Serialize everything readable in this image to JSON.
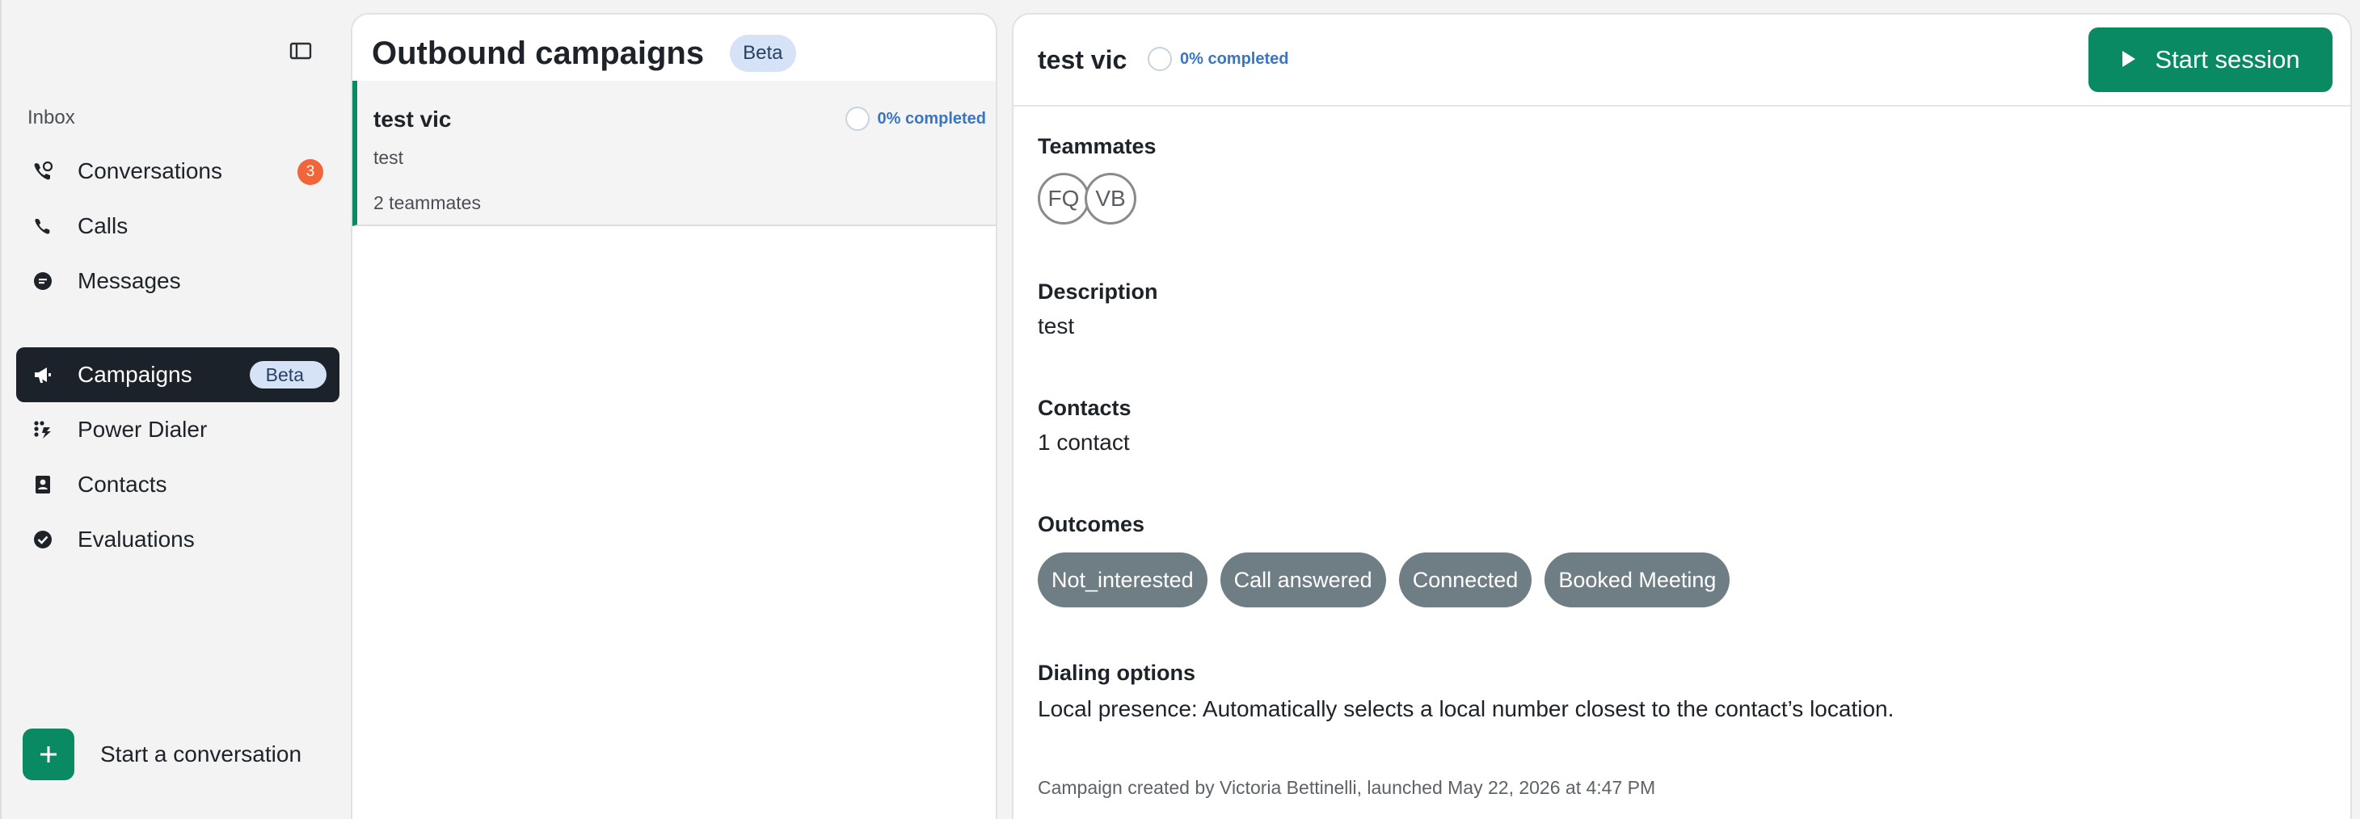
{
  "sidebar": {
    "section_label": "Inbox",
    "items": [
      {
        "label": "Conversations",
        "icon": "phone-chat-icon",
        "badge": "3"
      },
      {
        "label": "Calls",
        "icon": "phone-icon"
      },
      {
        "label": "Messages",
        "icon": "message-icon"
      },
      {
        "label": "Campaigns",
        "icon": "megaphone-icon",
        "badge": "Beta",
        "active": true
      },
      {
        "label": "Power Dialer",
        "icon": "power-dialer-icon"
      },
      {
        "label": "Contacts",
        "icon": "contacts-icon"
      },
      {
        "label": "Evaluations",
        "icon": "check-circle-icon"
      }
    ],
    "start_conversation": "Start a conversation"
  },
  "list": {
    "title": "Outbound campaigns",
    "beta": "Beta",
    "campaigns": [
      {
        "name": "test vic",
        "progress": "0% completed",
        "description": "test",
        "teammates": "2 teammates"
      }
    ]
  },
  "detail": {
    "title": "test vic",
    "progress": "0% completed",
    "start_session": "Start session",
    "teammates_label": "Teammates",
    "avatars": [
      "FQ",
      "VB"
    ],
    "description_label": "Description",
    "description": "test",
    "contacts_label": "Contacts",
    "contacts": "1 contact",
    "outcomes_label": "Outcomes",
    "outcomes": [
      "Not_interested",
      "Call answered",
      "Connected",
      "Booked Meeting"
    ],
    "dialing_label": "Dialing options",
    "dialing": "Local presence: Automatically selects a local number closest to the contact’s location.",
    "footer": "Campaign created by Victoria Bettinelli, launched May 22, 2026 at 4:47 PM"
  },
  "colors": {
    "accent": "#0a8a62",
    "badge": "#f0653a",
    "active_nav": "#1b2229",
    "beta_bg": "#d6e3f6",
    "progress_text": "#3a75c4",
    "chip": "#6f7d85"
  }
}
